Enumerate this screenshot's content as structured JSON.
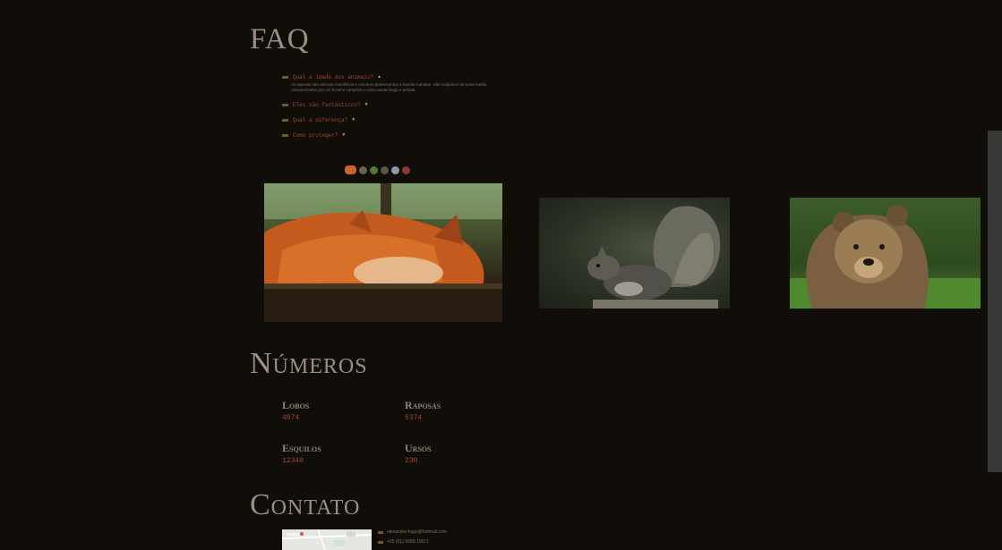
{
  "faq": {
    "title": "FAQ",
    "items": [
      {
        "question": "Qual a idade dos animais?",
        "answer": "As raposas são animais mamíferos e onívoros pertencentes à família Canidae. São vulpídeos de porte médio, caracterizados por um focinho comprido e uma cauda longa e peluda."
      },
      {
        "question": "Eles são fantásticos?"
      },
      {
        "question": "Qual a diferença?"
      },
      {
        "question": "Como proteger?"
      }
    ]
  },
  "gallery": {
    "icons": [
      "fox-icon",
      "squirrel-icon",
      "tree-icon",
      "bear-icon",
      "globe-icon",
      "flame-icon"
    ]
  },
  "numbers": {
    "title": "Números",
    "stats": [
      {
        "label": "Lobos",
        "value": "4874"
      },
      {
        "label": "Raposas",
        "value": "5374"
      },
      {
        "label": "Esquilos",
        "value": "12340"
      },
      {
        "label": "Ursos",
        "value": "230"
      }
    ]
  },
  "contact": {
    "title": "Contato",
    "email": "alexandre-hugo@hotmail.com",
    "phone": "+55 (61) 9300-10671"
  },
  "colors": {
    "background": "#110d08",
    "accent": "#a1482a",
    "heading": "#9b8f83"
  }
}
